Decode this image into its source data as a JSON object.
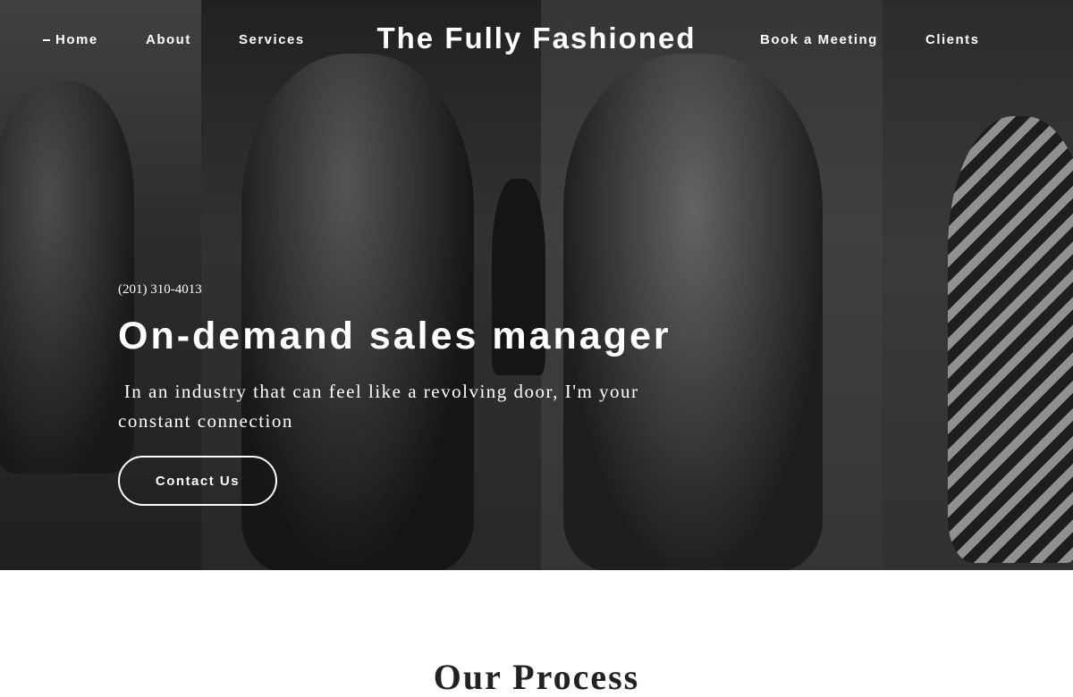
{
  "nav": {
    "home": "Home",
    "about": "About",
    "services": "Services",
    "book": "Book a Meeting",
    "clients": "Clients"
  },
  "site_title": "The Fully Fashioned",
  "hero": {
    "phone": "(201) 310-4013",
    "headline": "On-demand sales manager",
    "subtext": " In an industry that can feel like a revolving door, I'm your constant connection",
    "cta_label": "Contact Us"
  },
  "section": {
    "heading": "Our Process"
  },
  "colors": {
    "text": "#ffffff",
    "page_bg": "#ffffff",
    "heading_dark": "#222222"
  }
}
